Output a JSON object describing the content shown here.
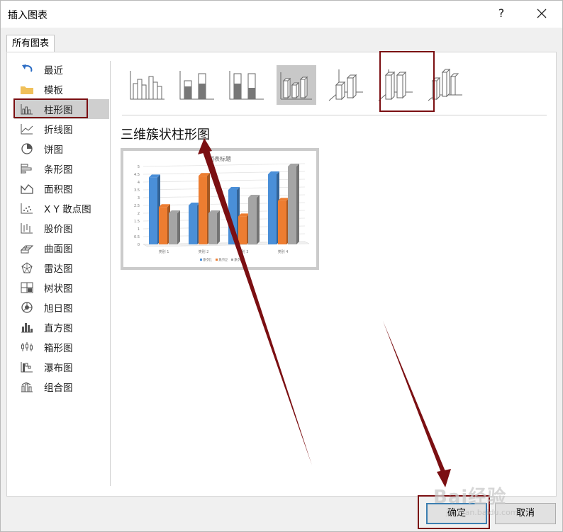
{
  "window": {
    "title": "插入图表",
    "help": "?"
  },
  "tab": {
    "label": "所有图表"
  },
  "sidebar": {
    "items": [
      {
        "label": "最近",
        "icon": "undo-arrow-icon"
      },
      {
        "label": "模板",
        "icon": "folder-icon"
      },
      {
        "label": "柱形图",
        "icon": "column-chart-icon",
        "selected": true
      },
      {
        "label": "折线图",
        "icon": "line-chart-icon"
      },
      {
        "label": "饼图",
        "icon": "pie-chart-icon"
      },
      {
        "label": "条形图",
        "icon": "bar-chart-icon"
      },
      {
        "label": "面积图",
        "icon": "area-chart-icon"
      },
      {
        "label": "X Y 散点图",
        "icon": "scatter-chart-icon"
      },
      {
        "label": "股价图",
        "icon": "stock-chart-icon"
      },
      {
        "label": "曲面图",
        "icon": "surface-chart-icon"
      },
      {
        "label": "雷达图",
        "icon": "radar-chart-icon"
      },
      {
        "label": "树状图",
        "icon": "treemap-chart-icon"
      },
      {
        "label": "旭日图",
        "icon": "sunburst-chart-icon"
      },
      {
        "label": "直方图",
        "icon": "histogram-chart-icon"
      },
      {
        "label": "箱形图",
        "icon": "box-whisker-chart-icon"
      },
      {
        "label": "瀑布图",
        "icon": "waterfall-chart-icon"
      },
      {
        "label": "组合图",
        "icon": "combo-chart-icon"
      }
    ]
  },
  "subtypes": {
    "selected_index": 3,
    "selected_name": "三维簇状柱形图"
  },
  "preview": {
    "chart_data": {
      "type": "bar",
      "title": "图表标题",
      "categories": [
        "类别 1",
        "类别 2",
        "类别 3",
        "类别 4"
      ],
      "series": [
        {
          "name": "系列1",
          "values": [
            4.3,
            2.5,
            3.5,
            4.5
          ],
          "color": "#4a8fd8"
        },
        {
          "name": "系列2",
          "values": [
            2.4,
            4.4,
            1.8,
            2.8
          ],
          "color": "#ed7d31"
        },
        {
          "name": "系列3",
          "values": [
            2.0,
            2.0,
            3.0,
            5.0
          ],
          "color": "#a5a5a5"
        }
      ],
      "ylim": [
        0,
        5
      ],
      "yticks": [
        "0",
        "0.5",
        "1",
        "1.5",
        "2",
        "2.5",
        "3",
        "3.5",
        "4",
        "4.5",
        "5"
      ],
      "grid": true,
      "legend": "bottom"
    }
  },
  "buttons": {
    "ok": "确定",
    "cancel": "取消"
  },
  "watermark": {
    "text": "Bai经验",
    "sub": "jingyan.baidu.com"
  },
  "colors": {
    "annotation": "#7b0f12",
    "accent": "#3c7fb1"
  }
}
